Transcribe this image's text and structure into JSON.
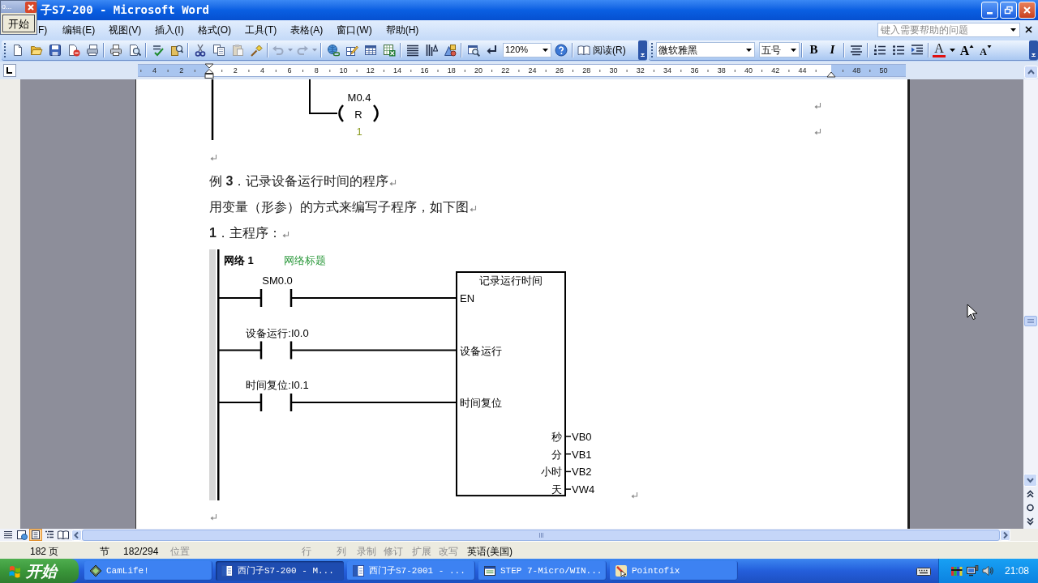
{
  "floating_window": {
    "title": "o...",
    "button": "开始"
  },
  "window": {
    "title": "子S7-200 - Microsoft Word"
  },
  "menu_bar": [
    "F)",
    "编辑(E)",
    "视图(V)",
    "插入(I)",
    "格式(O)",
    "工具(T)",
    "表格(A)",
    "窗口(W)",
    "帮助(H)"
  ],
  "help_search": {
    "placeholder": "键入需要帮助的问题"
  },
  "standard_toolbar": {
    "zoom": "120%",
    "read_button": "阅读(R)"
  },
  "formatting_toolbar": {
    "font": "微软雅黑",
    "font_size": "五号",
    "bold": "B",
    "italic": "I",
    "font_color": "A",
    "grow_font": "A",
    "shrink_font": "A"
  },
  "ruler": {
    "left_margin_labels": [
      "4",
      "2"
    ],
    "labels": [
      "2",
      "4",
      "6",
      "8",
      "10",
      "12",
      "14",
      "16",
      "18",
      "20",
      "22",
      "24",
      "26",
      "28",
      "30",
      "32",
      "34",
      "36",
      "38",
      "40",
      "42",
      "44"
    ],
    "right_margin_labels": [
      "48",
      "50"
    ]
  },
  "document": {
    "coil_rung": {
      "address": "M0.4",
      "instruction": "R",
      "value": "1"
    },
    "paragraphs": [
      "例 **3**．记录设备运行时间的程序",
      "用变量（形参）的方式来编写子程序，如下图",
      "**1**．主程序："
    ],
    "ladder": {
      "network": "网络 1",
      "network_title": "网络标题",
      "contacts": [
        "SM0.0",
        "设备运行:I0.0",
        "时间复位:I0.1"
      ],
      "block": {
        "title": "记录运行时间",
        "inputs": [
          "EN",
          "设备运行",
          "时间复位"
        ],
        "outputs": [
          {
            "pin": "秒",
            "operand": "VB0"
          },
          {
            "pin": "分",
            "operand": "VB1"
          },
          {
            "pin": "小时",
            "operand": "VB2"
          },
          {
            "pin": "天",
            "operand": "VW4"
          }
        ]
      }
    }
  },
  "view_buttons": [
    {
      "kind": "normal",
      "selected": false
    },
    {
      "kind": "web",
      "selected": false
    },
    {
      "kind": "print",
      "selected": true
    },
    {
      "kind": "outline",
      "selected": false
    },
    {
      "kind": "reading",
      "selected": false
    }
  ],
  "status_bar": [
    {
      "text": "182",
      "active": true
    },
    {
      "text": "页",
      "active": true
    },
    {
      "text": "节",
      "active": true
    },
    {
      "text": "182/294",
      "active": true
    },
    {
      "text": "位置",
      "active": false
    },
    {
      "text": "行",
      "active": false
    },
    {
      "text": "列",
      "active": false
    },
    {
      "text": "录制",
      "active": false
    },
    {
      "text": "修订",
      "active": false
    },
    {
      "text": "扩展",
      "active": false
    },
    {
      "text": "改写",
      "active": false
    },
    {
      "text": "英语(美国)",
      "active": true
    }
  ],
  "taskbar": {
    "start": "开始",
    "tasks": [
      {
        "label": "CamLife!",
        "kind": "camlife",
        "selected": false
      },
      {
        "label": "西门子S7-200 - M...",
        "kind": "word",
        "selected": true
      },
      {
        "label": "西门子S7-2001 - ...",
        "kind": "word",
        "selected": false
      },
      {
        "label": "STEP 7-Micro/WIN...",
        "kind": "step7",
        "selected": false
      },
      {
        "label": "Pointofix",
        "kind": "pointofix",
        "selected": false
      }
    ],
    "clock": "21:08"
  }
}
